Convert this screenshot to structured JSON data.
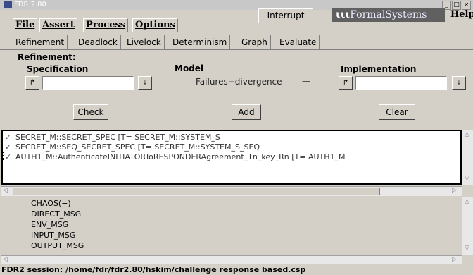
{
  "window": {
    "title": "FDR 2.80",
    "min_label": "_",
    "max_label": "□",
    "close_label": "×",
    "title_color": "#c8c8c8"
  },
  "menu": {
    "file": "File",
    "assert": "Assert",
    "process": "Process",
    "options": "Options",
    "interrupt": "Interrupt",
    "logo": "FormalSystems",
    "help": "Help"
  },
  "tabs": [
    "Refinement",
    "Deadlock",
    "Livelock",
    "Determinism",
    "Graph",
    "Evaluate"
  ],
  "refinement": {
    "heading": "Refinement:",
    "spec_label": "Specification",
    "model_label": "Model",
    "impl_label": "Implementation",
    "model_value": "Failures−divergence",
    "model_dash": "—",
    "spec_value": "",
    "impl_value": "",
    "check": "Check",
    "add": "Add",
    "clear": "Clear"
  },
  "results": [
    "SECRET_M::SECRET_SPEC [T= SECRET_M::SYSTEM_S",
    "SECRET_M::SEQ_SECRET_SPEC [T= SECRET_M::SYSTEM_S_SEQ",
    "AUTH1_M::AuthenticateINITIATORToRESPONDERAgreement_Tn_key_Rn [T= AUTH1_M"
  ],
  "processes": [
    "CHAOS(−)",
    "DIRECT_MSG",
    "ENV_MSG",
    "INPUT_MSG",
    "OUTPUT_MSG"
  ],
  "status": "FDR2 session: /home/fdr/fdr2.80/hskim/challenge response based.csp"
}
